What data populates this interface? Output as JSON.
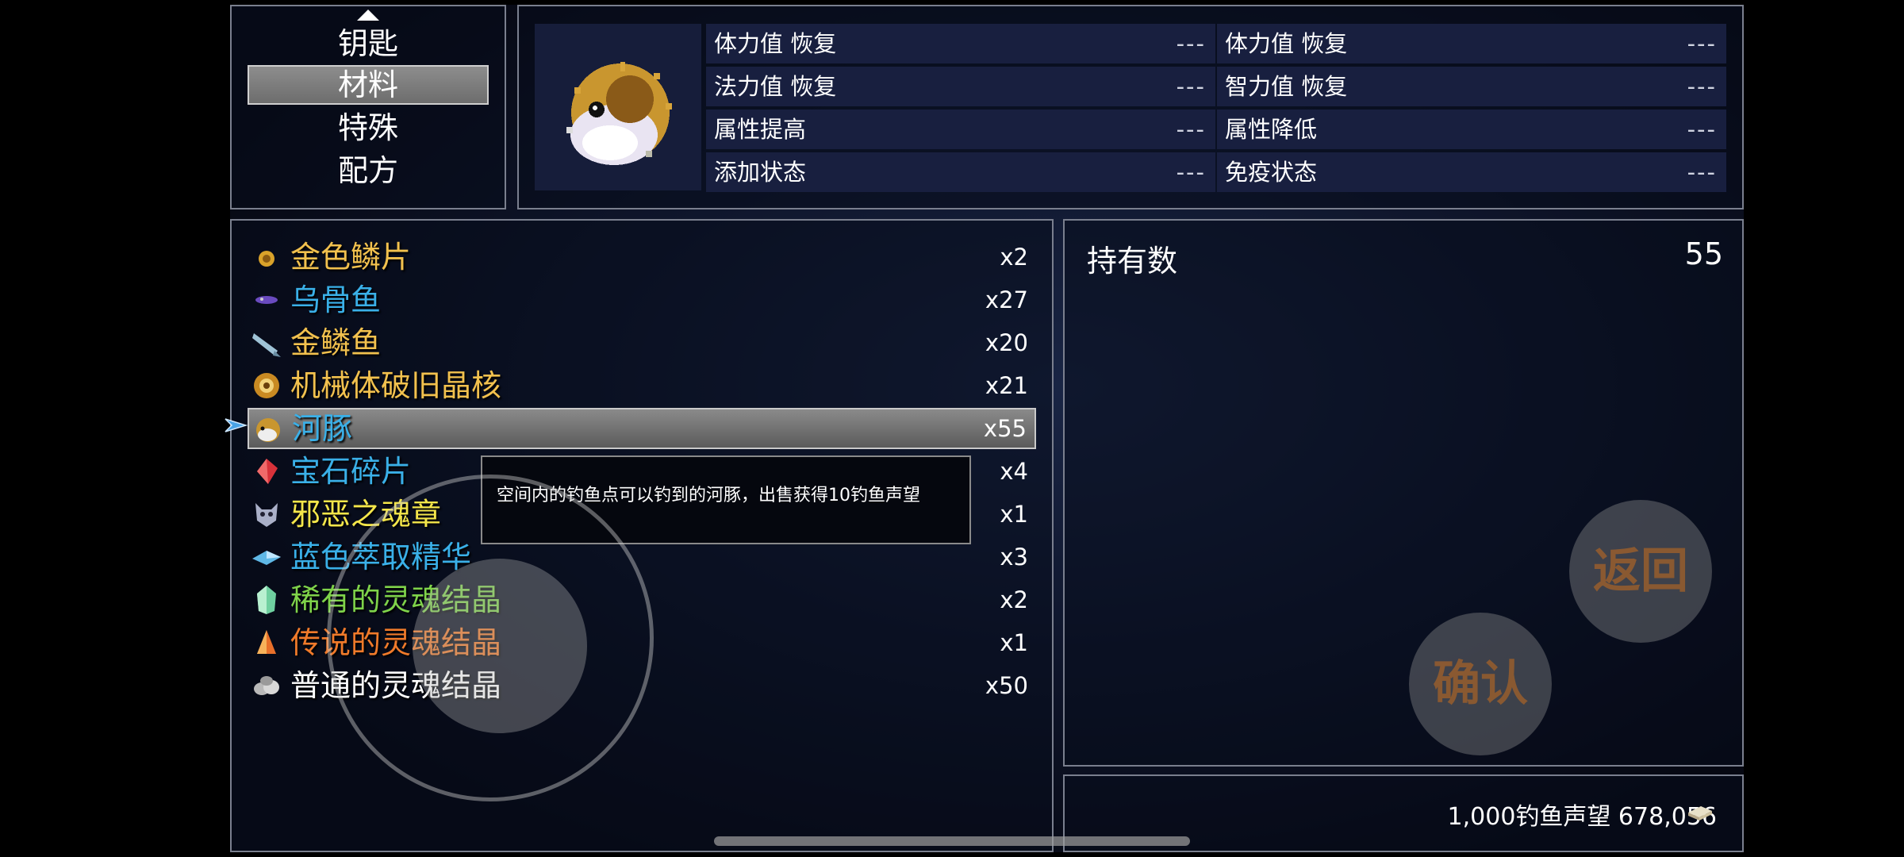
{
  "categories": {
    "items": [
      "钥匙",
      "材料",
      "特殊",
      "配方"
    ],
    "selected": "材料"
  },
  "item_detail": {
    "stats": [
      {
        "label": "体力值 恢复",
        "value": "---"
      },
      {
        "label": "体力值 恢复",
        "value": "---"
      },
      {
        "label": "法力值 恢复",
        "value": "---"
      },
      {
        "label": "智力值 恢复",
        "value": "---"
      },
      {
        "label": "属性提高",
        "value": "---"
      },
      {
        "label": "属性降低",
        "value": "---"
      },
      {
        "label": "添加状态",
        "value": "---"
      },
      {
        "label": "免疫状态",
        "value": "---"
      }
    ]
  },
  "items": [
    {
      "name": "金色鳞片",
      "qty": "x2",
      "color": "#f2c14e",
      "icon": "gold-scale-icon"
    },
    {
      "name": "乌骨鱼",
      "qty": "x27",
      "color": "#3ab0e8",
      "icon": "purple-fish-icon"
    },
    {
      "name": "金鳞鱼",
      "qty": "x20",
      "color": "#f2c14e",
      "icon": "silver-fish-icon"
    },
    {
      "name": "机械体破旧晶核",
      "qty": "x21",
      "color": "#f2c14e",
      "icon": "gear-core-icon"
    },
    {
      "name": "河豚",
      "qty": "x55",
      "color": "#3ab0e8",
      "icon": "pufferfish-icon"
    },
    {
      "name": "宝石碎片",
      "qty": "x4",
      "color": "#3ab0e8",
      "icon": "red-gem-icon"
    },
    {
      "name": "邪恶之魂章",
      "qty": "x1",
      "color": "#f4e64a",
      "icon": "demon-mask-icon"
    },
    {
      "name": "蓝色萃取精华",
      "qty": "x3",
      "color": "#3ab0e8",
      "icon": "blue-crystal-icon"
    },
    {
      "name": "稀有的灵魂结晶",
      "qty": "x2",
      "color": "#7fd34a",
      "icon": "green-crystal-icon"
    },
    {
      "name": "传说的灵魂结晶",
      "qty": "x1",
      "color": "#f07a2a",
      "icon": "orange-crystal-icon"
    },
    {
      "name": "普通的灵魂结晶",
      "qty": "x50",
      "color": "#ffffff",
      "icon": "grey-stone-icon"
    }
  ],
  "selected_item_index": 4,
  "tooltip": "空间内的钓鱼点可以钓到的河豚，出售获得10钓鱼声望",
  "owned": {
    "label": "持有数",
    "value": "55"
  },
  "currency": {
    "text": "1,000钓鱼声望 678,056",
    "icon": "coin-stack-icon"
  },
  "controls": {
    "back_label": "返回",
    "confirm_label": "确认"
  }
}
